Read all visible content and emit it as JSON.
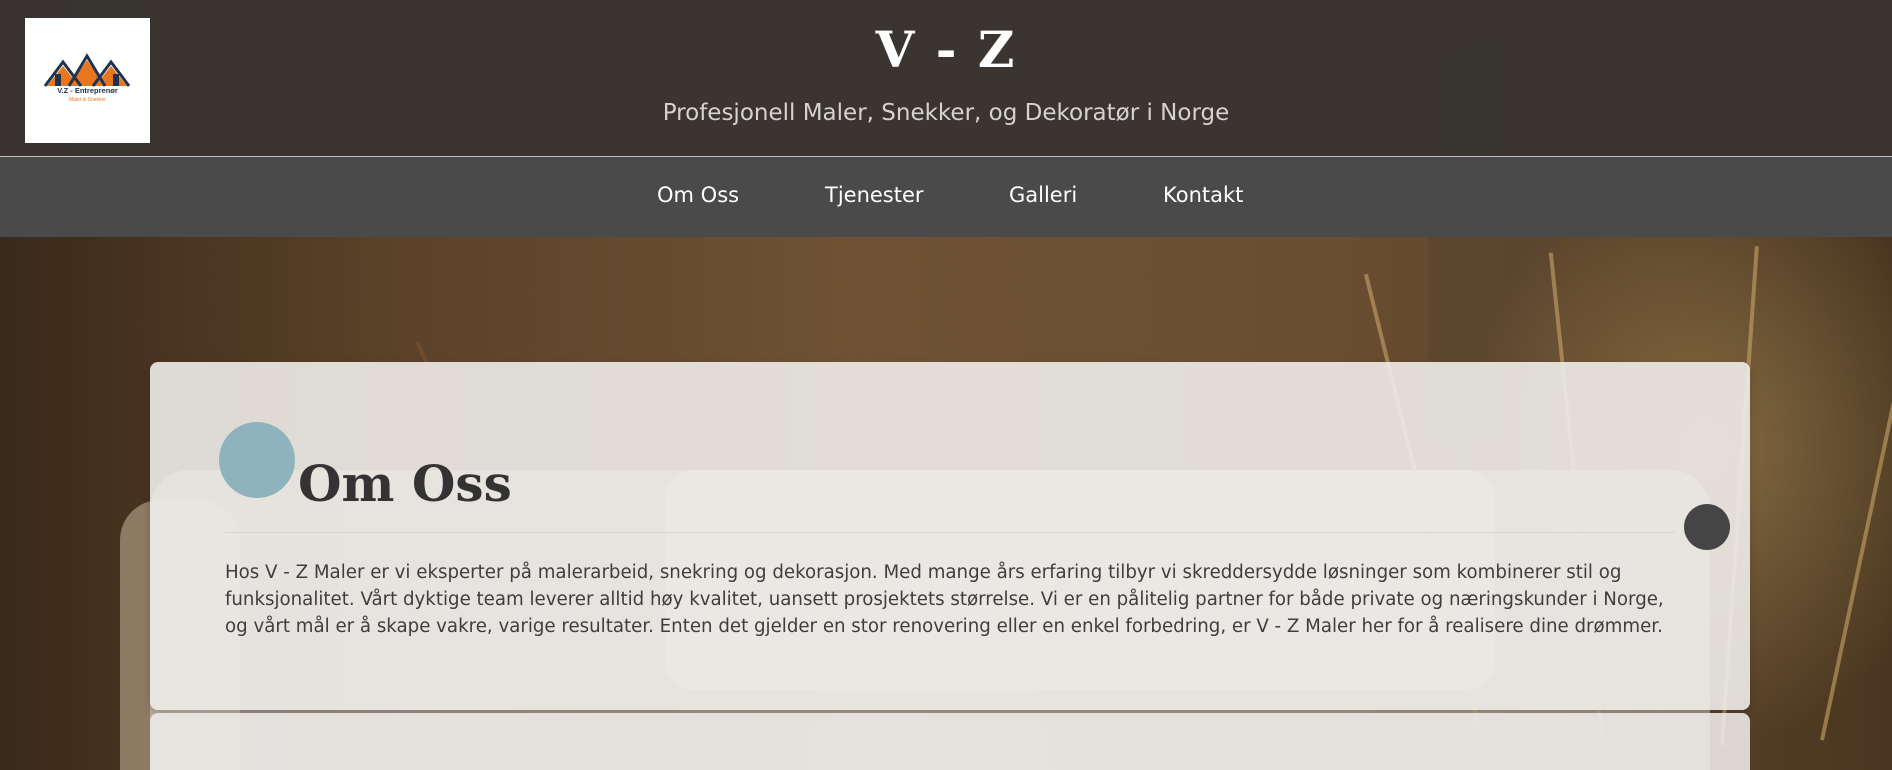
{
  "header": {
    "title": "V - Z",
    "tagline": "Profesjonell Maler, Snekker, og Dekoratør i Norge",
    "logo": {
      "text": "V.Z - Entreprenør",
      "subtext": "Maler & Snekker"
    }
  },
  "nav": {
    "items": [
      {
        "label": "Om Oss"
      },
      {
        "label": "Tjenester"
      },
      {
        "label": "Galleri"
      },
      {
        "label": "Kontakt"
      }
    ]
  },
  "about": {
    "title": "Om Oss",
    "text": "Hos V - Z Maler er vi eksperter på malerarbeid, snekring og dekorasjon. Med mange års erfaring tilbyr vi skreddersydde løsninger som kombinerer stil og funksjonalitet. Vårt dyktige team leverer alltid høy kvalitet, uansett prosjektets størrelse. Vi er en pålitelig partner for både private og næringskunder i Norge, og vårt mål er å skape vakre, varige resultater. Enten det gjelder en stor renovering eller en enkel forbedring, er V - Z Maler her for å realisere dine drømmer."
  },
  "colors": {
    "header_bg": "#383431",
    "nav_bg": "#4a4a4a",
    "accent_dot": "#8fb3bd",
    "side_dot": "#454545",
    "logo_orange": "#e8761e",
    "logo_navy": "#1f3350"
  }
}
